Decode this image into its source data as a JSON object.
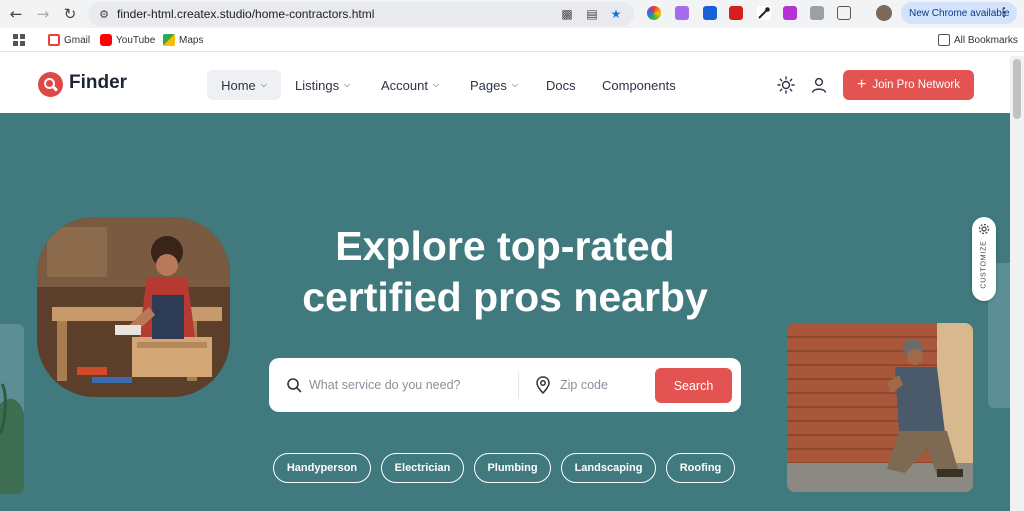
{
  "browser": {
    "url": "finder-html.createx.studio/home-contractors.html",
    "new_chrome_label": "New Chrome available",
    "bookmarks": [
      "Gmail",
      "YouTube",
      "Maps"
    ],
    "all_bookmarks_label": "All Bookmarks"
  },
  "header": {
    "logo_text": "Finder",
    "nav": [
      {
        "label": "Home",
        "has_dropdown": true
      },
      {
        "label": "Listings",
        "has_dropdown": true
      },
      {
        "label": "Account",
        "has_dropdown": true
      },
      {
        "label": "Pages",
        "has_dropdown": true
      },
      {
        "label": "Docs",
        "has_dropdown": false
      },
      {
        "label": "Components",
        "has_dropdown": false
      }
    ],
    "join_label": "Join Pro Network"
  },
  "hero": {
    "title_line1": "Explore top-rated",
    "title_line2": "certified pros nearby",
    "search": {
      "service_placeholder": "What service do you need?",
      "zip_placeholder": "Zip code",
      "button_label": "Search"
    },
    "categories": [
      "Handyperson",
      "Electrician",
      "Plumbing",
      "Landscaping",
      "Roofing"
    ]
  },
  "customize_label": "CUSTOMIZE",
  "colors": {
    "accent": "#e25351",
    "hero_bg": "#407a7f",
    "text_dark": "#1d2433"
  }
}
